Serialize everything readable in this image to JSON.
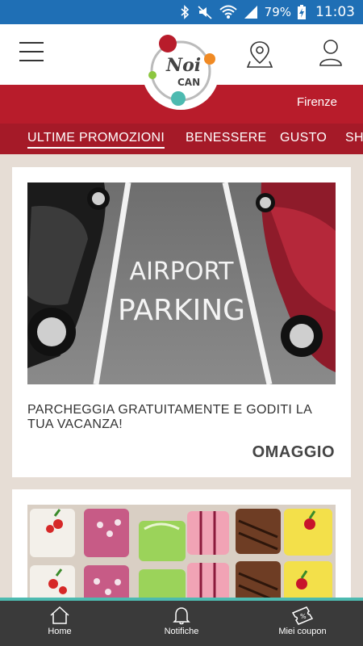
{
  "status_bar": {
    "battery": "79%",
    "time": "11:03"
  },
  "header": {
    "logo_text_top": "Noi",
    "logo_text_bottom": "CAN"
  },
  "location": {
    "city": "Firenze"
  },
  "tabs": [
    {
      "label": "ULTIME PROMOZIONI",
      "active": true
    },
    {
      "label": "BENESSERE",
      "active": false
    },
    {
      "label": "GUSTO",
      "active": false
    },
    {
      "label": "SH",
      "active": false
    }
  ],
  "promos": [
    {
      "image_text_1": "AIRPORT",
      "image_text_2": "PARKING",
      "title": "PARCHEGGIA GRATUITAMENTE E GODITI LA TUA VACANZA!",
      "tag": "OMAGGIO"
    }
  ],
  "bottom_nav": [
    {
      "label": "Home",
      "icon": "home-icon"
    },
    {
      "label": "Notifiche",
      "icon": "bell-icon"
    },
    {
      "label": "Miei coupon",
      "icon": "coupon-icon"
    }
  ],
  "colors": {
    "status_bar": "#1f6fb5",
    "brand_red": "#b81c2b",
    "tab_red": "#a51a28",
    "accent_teal": "#4dbab0",
    "bottom_nav": "#3a3a3a"
  }
}
